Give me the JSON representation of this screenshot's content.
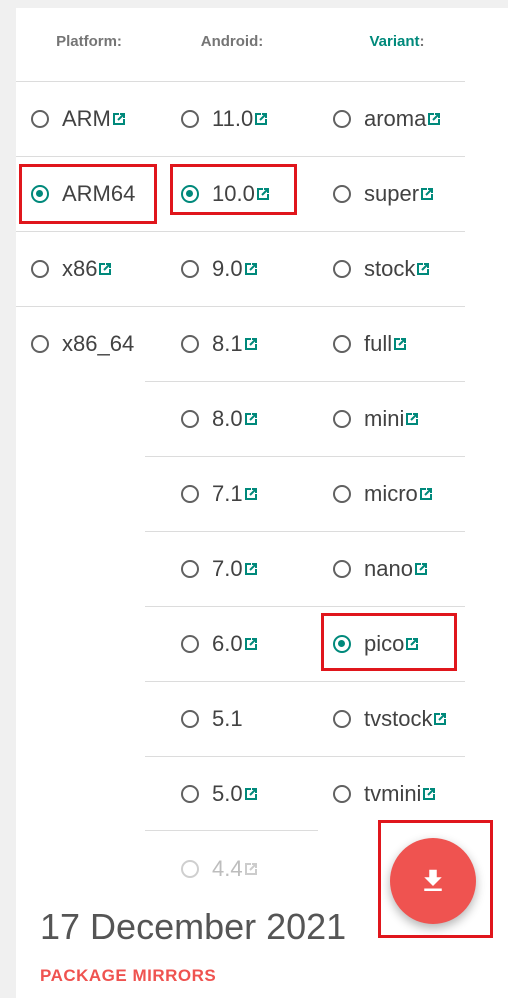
{
  "headers": {
    "platform": "Platform:",
    "android": "Android:",
    "variant": "Variant",
    "variant_colon": ":"
  },
  "platform": [
    {
      "label": "ARM",
      "selected": false,
      "link": true
    },
    {
      "label": "ARM64",
      "selected": true,
      "link": false
    },
    {
      "label": "x86",
      "selected": false,
      "link": true
    },
    {
      "label": "x86_64",
      "selected": false,
      "link": false
    }
  ],
  "android": [
    {
      "label": "11.0",
      "selected": false,
      "link": true,
      "disabled": false
    },
    {
      "label": "10.0",
      "selected": true,
      "link": true,
      "disabled": false
    },
    {
      "label": "9.0",
      "selected": false,
      "link": true,
      "disabled": false
    },
    {
      "label": "8.1",
      "selected": false,
      "link": true,
      "disabled": false
    },
    {
      "label": "8.0",
      "selected": false,
      "link": true,
      "disabled": false
    },
    {
      "label": "7.1",
      "selected": false,
      "link": true,
      "disabled": false
    },
    {
      "label": "7.0",
      "selected": false,
      "link": true,
      "disabled": false
    },
    {
      "label": "6.0",
      "selected": false,
      "link": true,
      "disabled": false
    },
    {
      "label": "5.1",
      "selected": false,
      "link": false,
      "disabled": false
    },
    {
      "label": "5.0",
      "selected": false,
      "link": true,
      "disabled": false
    },
    {
      "label": "4.4",
      "selected": false,
      "link": true,
      "disabled": true
    }
  ],
  "variant": [
    {
      "label": "aroma",
      "selected": false,
      "link": true
    },
    {
      "label": "super",
      "selected": false,
      "link": true
    },
    {
      "label": "stock",
      "selected": false,
      "link": true
    },
    {
      "label": "full",
      "selected": false,
      "link": true
    },
    {
      "label": "mini",
      "selected": false,
      "link": true
    },
    {
      "label": "micro",
      "selected": false,
      "link": true
    },
    {
      "label": "nano",
      "selected": false,
      "link": true
    },
    {
      "label": "pico",
      "selected": true,
      "link": true
    },
    {
      "label": "tvstock",
      "selected": false,
      "link": true
    },
    {
      "label": "tvmini",
      "selected": false,
      "link": true
    }
  ],
  "date": "17 December 2021",
  "mirrors_label": "PACKAGE MIRRORS",
  "download_icon": "download-icon",
  "colors": {
    "accent": "#00897b",
    "fab": "#ef5350",
    "highlight": "#e0161c"
  }
}
